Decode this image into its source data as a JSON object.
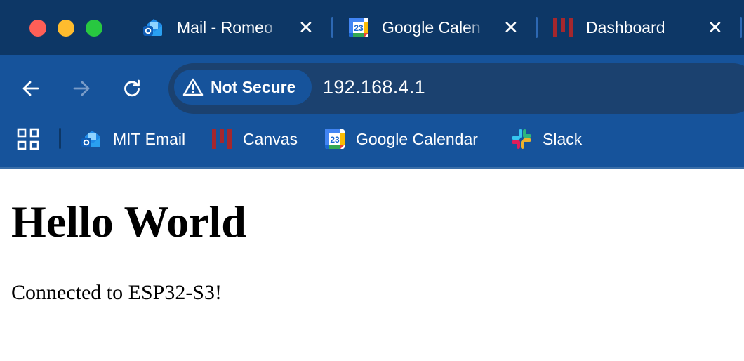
{
  "window_controls": {
    "close": "close",
    "minimize": "minimize",
    "zoom": "zoom"
  },
  "tabs": [
    {
      "title": "Mail - Romeo",
      "icon": "outlook-icon",
      "active": false
    },
    {
      "title": "Google Calen",
      "icon": "google-calendar-icon",
      "active": false
    },
    {
      "title": "Dashboard",
      "icon": "canvas-icon",
      "active": false
    }
  ],
  "toolbar": {
    "security_label": "Not Secure",
    "url": "192.168.4.1"
  },
  "bookmarks": [
    {
      "label": "MIT Email",
      "icon": "outlook-icon"
    },
    {
      "label": "Canvas",
      "icon": "canvas-icon"
    },
    {
      "label": "Google Calendar",
      "icon": "google-calendar-icon"
    },
    {
      "label": "Slack",
      "icon": "slack-icon"
    }
  ],
  "page": {
    "heading": "Hello World",
    "paragraph": "Connected to ESP32-S3!"
  },
  "colors": {
    "tabstrip_bg": "#0d3766",
    "toolbar_bg": "#16539b",
    "omnibox_bg": "#1b416f",
    "canvas_red": "#a5272d",
    "calendar_blue": "#1a73e8"
  },
  "calendar_icon_day": "23"
}
